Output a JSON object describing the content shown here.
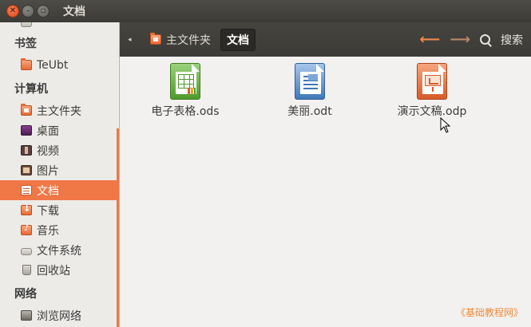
{
  "window": {
    "title": "文档",
    "close_glyph": "✕",
    "min_glyph": "–",
    "max_glyph": "▫"
  },
  "sidebar": {
    "partial_top_label": "ユー文件",
    "sections": [
      {
        "heading": "书签",
        "items": [
          {
            "label": "TeUbt",
            "icon": "folder-icon"
          }
        ]
      },
      {
        "heading": "计算机",
        "items": [
          {
            "label": "主文件夹",
            "icon": "home-folder-icon"
          },
          {
            "label": "桌面",
            "icon": "desktop-icon"
          },
          {
            "label": "视频",
            "icon": "video-icon"
          },
          {
            "label": "图片",
            "icon": "pictures-icon"
          },
          {
            "label": "文档",
            "icon": "documents-icon",
            "active": true
          },
          {
            "label": "下载",
            "icon": "download-icon"
          },
          {
            "label": "音乐",
            "icon": "music-icon"
          },
          {
            "label": "文件系统",
            "icon": "filesystem-icon"
          },
          {
            "label": "回收站",
            "icon": "trash-icon"
          }
        ]
      },
      {
        "heading": "网络",
        "items": [
          {
            "label": "浏览网络",
            "icon": "network-icon"
          }
        ]
      }
    ]
  },
  "toolbar": {
    "back_toggle_glyph": "◂",
    "breadcrumbs": [
      {
        "label": "主文件夹",
        "icon": "home-folder-icon"
      },
      {
        "label": "文档",
        "active": true
      }
    ],
    "back_arrow": "🡐",
    "forward_arrow": "🡒",
    "search_label": "搜索"
  },
  "files": [
    {
      "name": "电子表格.ods",
      "type": "spreadsheet"
    },
    {
      "name": "美丽.odt",
      "type": "text-document"
    },
    {
      "name": "演示文稿.odp",
      "type": "presentation"
    }
  ],
  "watermark": "《基础教程网》",
  "colors": {
    "accent": "#f07746",
    "titlebar": "#3c3b37",
    "content_bg": "#f2f1f0",
    "sidebar_bg": "#ecebe8"
  }
}
